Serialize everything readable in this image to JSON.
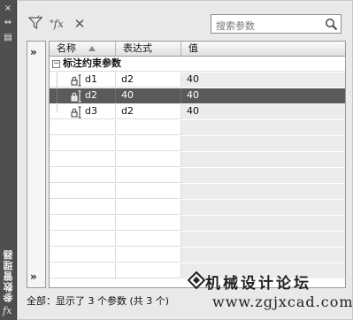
{
  "strip": {
    "title": "参数管理器",
    "fx": "fx",
    "buttons": [
      "×",
      "⇔",
      "▤"
    ]
  },
  "toolbar": {
    "icons": [
      "filter-icon",
      "user-parameter-fx-icon",
      "delete-icon"
    ],
    "delete_glyph": "✕",
    "fx_glyph": "fx",
    "search_placeholder": "搜索参数"
  },
  "tree": {
    "expand_top": "»",
    "expand_bottom": "»"
  },
  "grid": {
    "columns": [
      "名称",
      "表达式",
      "值"
    ],
    "group": {
      "expander": "−",
      "label": "标注约束参数"
    },
    "rows": [
      {
        "name": "d1",
        "expression": "d2",
        "value": "40",
        "selected": false
      },
      {
        "name": "d2",
        "expression": "40",
        "value": "40",
        "selected": true
      },
      {
        "name": "d3",
        "expression": "d2",
        "value": "40",
        "selected": false
      }
    ]
  },
  "status": {
    "text": "全部：显示了 3 个参数 (共 3 个)"
  },
  "watermark": {
    "title": "机械设计论坛",
    "url": "www.zgjxcad.com"
  },
  "colors": {
    "selection": "#5a5a5a",
    "value_column": "#ececec",
    "strip": "#4f4f4f"
  }
}
